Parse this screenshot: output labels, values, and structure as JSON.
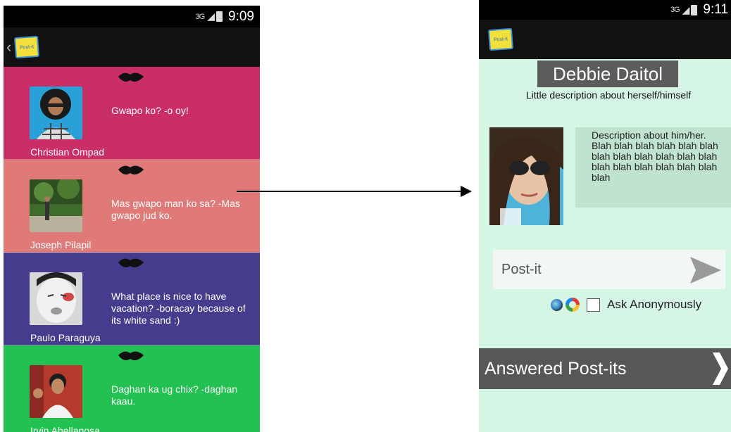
{
  "left_phone": {
    "status_time": "9:09",
    "network": "3G",
    "feed": [
      {
        "user": "Christian Ompad",
        "message": "Gwapo ko? -o oy!",
        "bg": "#c92f66"
      },
      {
        "user": "Joseph Pilapil",
        "message": "Mas gwapo man ko sa? -Mas gwapo jud ko.",
        "bg": "#df7a78"
      },
      {
        "user": "Paulo Paraguya",
        "message": "What place is nice to have vacation? -boracay because of its white sand :)",
        "bg": "#463c8d"
      },
      {
        "user": "Irvin Abellanosa",
        "message": "Daghan ka ug chix? -daghan kaau.",
        "bg": "#23c052"
      }
    ]
  },
  "right_phone": {
    "status_time": "9:11",
    "network": "3G",
    "profile_name": "Debbie Daitol",
    "profile_subtitle": "Little description about herself/himself",
    "description": "Description about him/her. Blah blah blah blah blah blah blah blah blah blah blah blah blah blah blah blah blah blah blah",
    "post_placeholder": "Post-it",
    "ask_anonymously_label": "Ask Anonymously",
    "answered_label": "Answered Post-its"
  },
  "logo_text": "Post-it",
  "icons": [
    "back-chevron-icon",
    "post-it-logo-icon",
    "lips-icon",
    "send-icon",
    "color-dot-icon",
    "chevron-right-icon"
  ]
}
